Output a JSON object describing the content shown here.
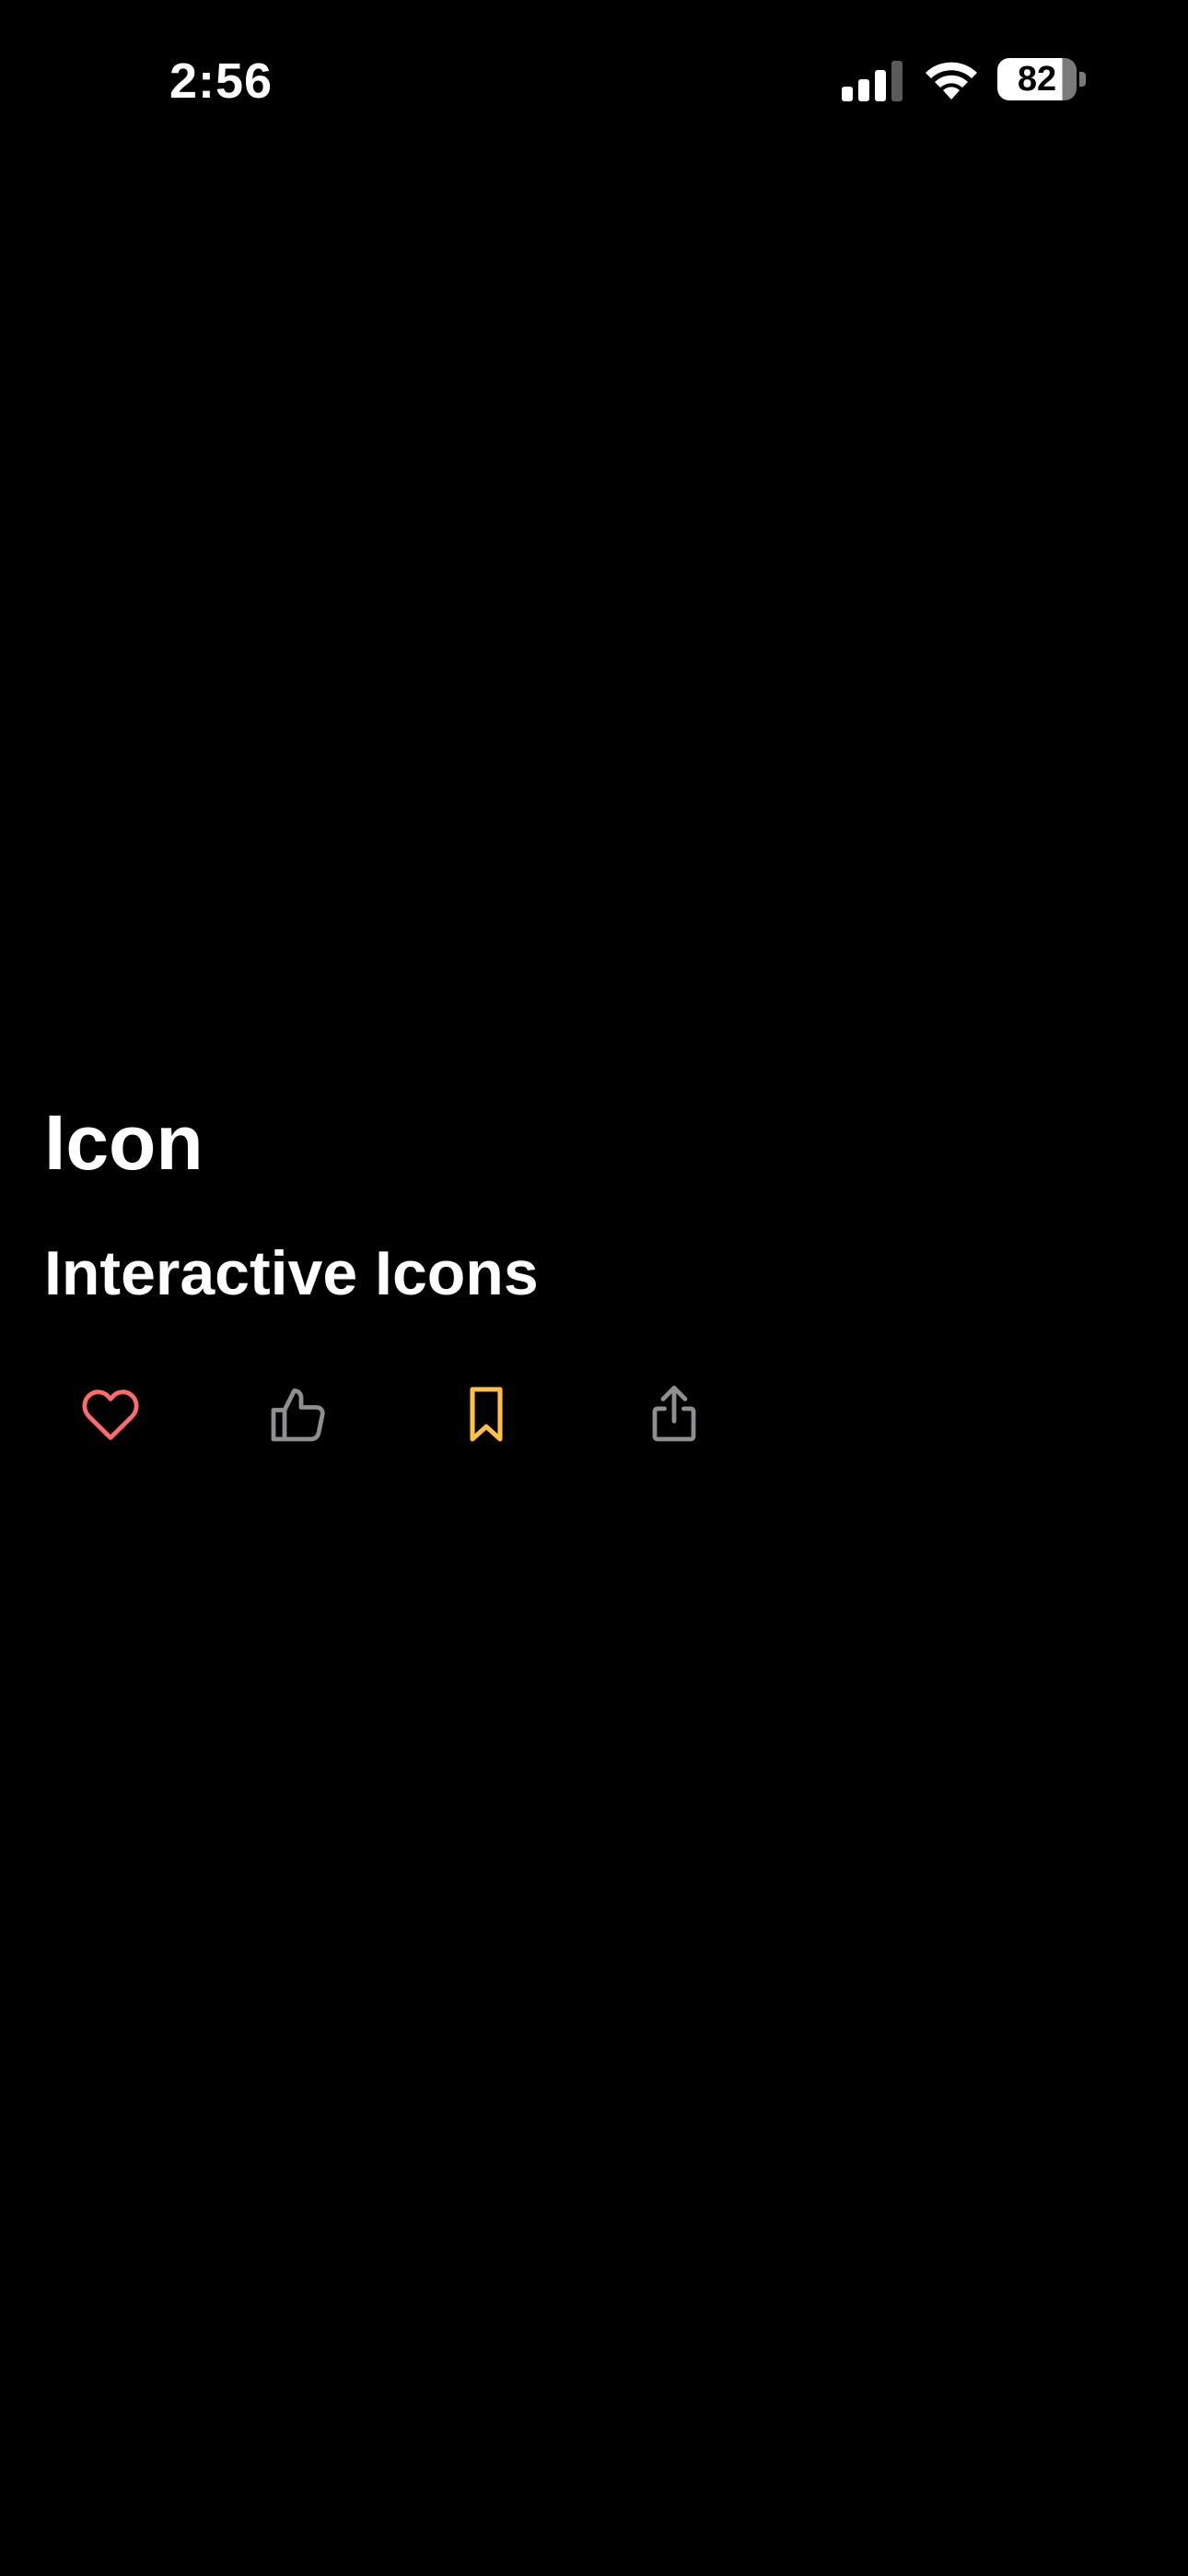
{
  "status_bar": {
    "time": "2:56",
    "battery_level": "82",
    "signal_icon": "cellular-signal-icon",
    "wifi_icon": "wifi-icon",
    "battery_icon": "battery-icon"
  },
  "page": {
    "title": "Icon",
    "section_title": "Interactive Icons"
  },
  "icons": [
    {
      "name": "heart-icon",
      "color": "#ff6b6b"
    },
    {
      "name": "thumbs-up-icon",
      "color": "#8e8e93"
    },
    {
      "name": "bookmark-icon",
      "color": "#ffc145"
    },
    {
      "name": "share-icon",
      "color": "#8e8e93"
    }
  ],
  "colors": {
    "background": "#000000",
    "text": "#ffffff",
    "heart": "#ff6b6b",
    "bookmark": "#ffc145",
    "muted": "#8e8e93"
  }
}
